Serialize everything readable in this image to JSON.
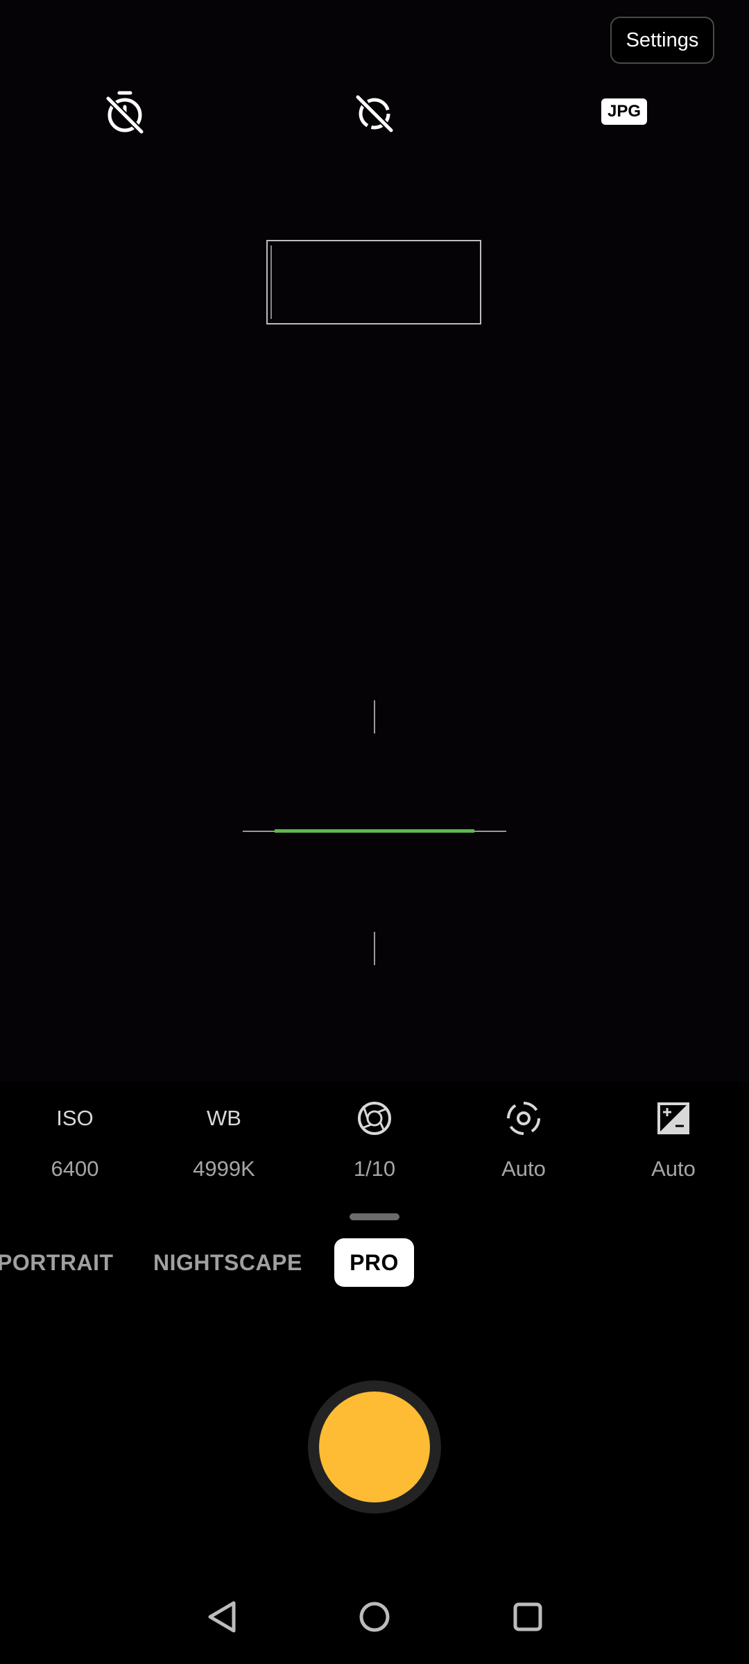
{
  "top_bar": {
    "settings_label": "Settings",
    "timer_icon": "timer-off-icon",
    "motion_icon": "motion-off-icon",
    "format_label": "JPG"
  },
  "pro_params": [
    {
      "name": "ISO",
      "value": "6400"
    },
    {
      "name": "WB",
      "value": "4999K"
    },
    {
      "icon": "aperture-shutter-icon",
      "value": "1/10"
    },
    {
      "icon": "focus-icon",
      "value": "Auto"
    },
    {
      "icon": "exposure-icon",
      "value": "Auto"
    }
  ],
  "modes": {
    "portrait": "PORTRAIT",
    "nightscape": "NIGHTSCAPE",
    "pro": "PRO",
    "active": "PRO"
  },
  "colors": {
    "shutter": "#fdbc33",
    "level_green": "#5fb64c"
  },
  "nav": {
    "back_icon": "back-triangle-icon",
    "home_icon": "home-circle-icon",
    "recents_icon": "recents-square-icon"
  }
}
